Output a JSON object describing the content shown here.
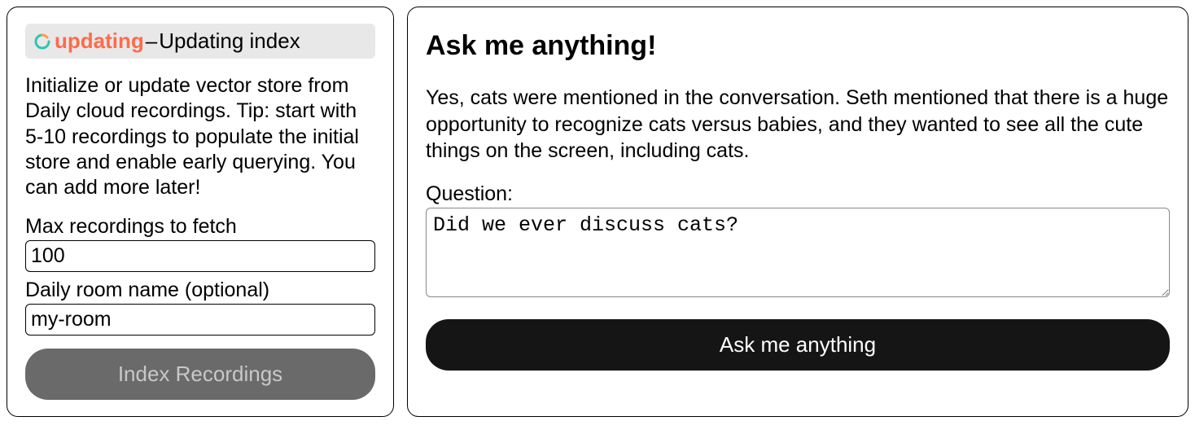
{
  "left": {
    "status": {
      "label": "updating",
      "text": "Updating index"
    },
    "description": "Initialize or update vector store from Daily cloud recordings. Tip: start with 5-10 recordings to populate the initial store and enable early querying. You can add more later!",
    "max_recordings": {
      "label": "Max recordings to fetch",
      "value": "100"
    },
    "room_name": {
      "label": "Daily room name (optional)",
      "value": "my-room"
    },
    "index_button": "Index Recordings"
  },
  "right": {
    "title": "Ask me anything!",
    "answer": "Yes, cats were mentioned in the conversation. Seth mentioned that there is a huge opportunity to recognize cats versus babies, and they wanted to see all the cute things on the screen, including cats.",
    "question": {
      "label": "Question:",
      "value": "Did we ever discuss cats?"
    },
    "ask_button": "Ask me anything"
  }
}
